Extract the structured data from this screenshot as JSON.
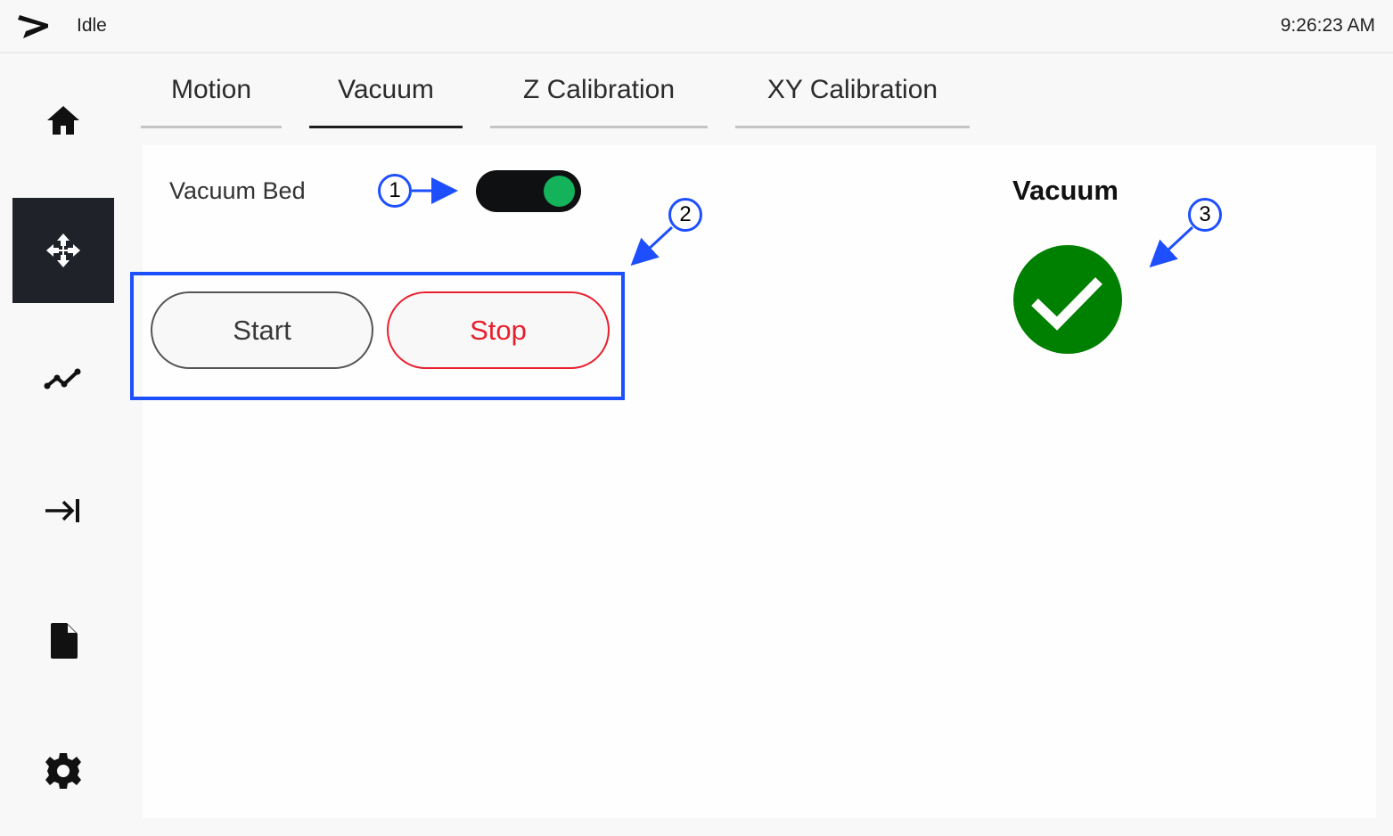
{
  "header": {
    "logo_icon": "arrow-logo-icon",
    "status": "Idle",
    "time": "9:26:23 AM"
  },
  "sidebar": {
    "items": [
      {
        "name": "home",
        "icon": "home-icon",
        "active": false
      },
      {
        "name": "motion",
        "icon": "move-arrows-icon",
        "active": true
      },
      {
        "name": "graph",
        "icon": "line-chart-icon",
        "active": false
      },
      {
        "name": "jog",
        "icon": "arrow-to-line-icon",
        "active": false
      },
      {
        "name": "file",
        "icon": "file-icon",
        "active": false
      },
      {
        "name": "settings",
        "icon": "gear-icon",
        "active": false
      }
    ]
  },
  "tabs": [
    {
      "label": "Motion",
      "active": false
    },
    {
      "label": "Vacuum",
      "active": true
    },
    {
      "label": "Z Calibration",
      "active": false
    },
    {
      "label": "XY Calibration",
      "active": false
    }
  ],
  "vacuum": {
    "bed_label": "Vacuum Bed",
    "bed_toggle_on": true,
    "start_label": "Start",
    "stop_label": "Stop",
    "status_title": "Vacuum",
    "status_state": "ok",
    "status_icon": "check-circle-icon"
  },
  "colors": {
    "accent_dark": "#1f2329",
    "toggle_on": "#14b25a",
    "stop_red": "#e8202e",
    "status_green": "#008000",
    "annotation_blue": "#1e4fff"
  },
  "annotations": [
    "1",
    "2",
    "3"
  ]
}
